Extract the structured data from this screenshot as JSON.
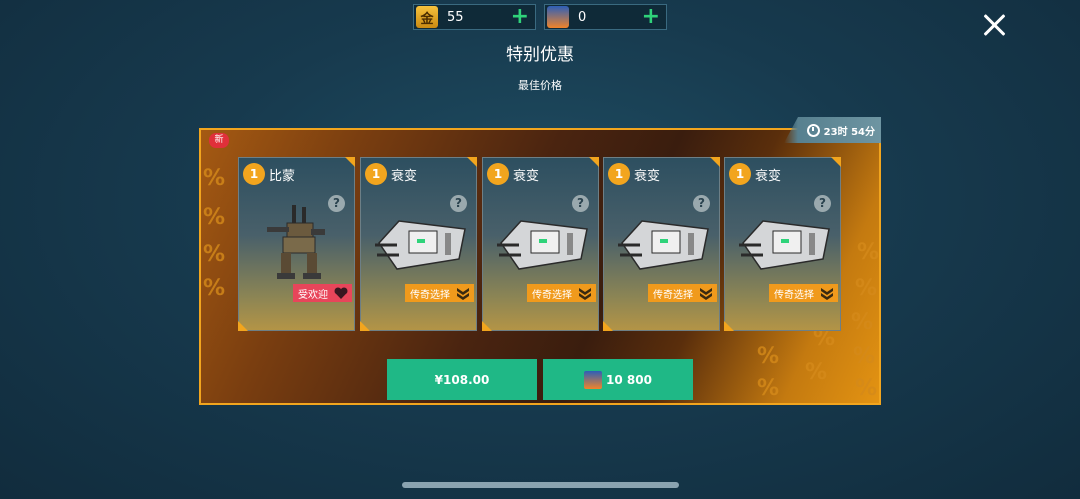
{
  "currency": {
    "gold": {
      "icon_text": "金",
      "value": "55"
    },
    "gems": {
      "value": "0"
    },
    "plus": "+"
  },
  "header": {
    "title": "特别优惠",
    "subtitle": "最佳价格"
  },
  "badge_new": "新",
  "timer": "23时 54分",
  "cards": [
    {
      "qty": "1",
      "name": "比蒙",
      "tag": "受欢迎",
      "help": "?"
    },
    {
      "qty": "1",
      "name": "衰变",
      "tag": "传奇选择",
      "help": "?"
    },
    {
      "qty": "1",
      "name": "衰变",
      "tag": "传奇选择",
      "help": "?"
    },
    {
      "qty": "1",
      "name": "衰变",
      "tag": "传奇选择",
      "help": "?"
    },
    {
      "qty": "1",
      "name": "衰变",
      "tag": "传奇选择",
      "help": "?"
    }
  ],
  "buttons": {
    "price_money": "¥108.00",
    "price_gems": "10 800"
  },
  "colors": {
    "accent_orange": "#f2a51e",
    "buy_green": "#1fb886",
    "plus_green": "#2fd37a",
    "popular_red": "#e8455a"
  },
  "icons": {
    "close": "close-icon",
    "clock": "clock-icon",
    "help": "question-icon",
    "popular": "heart-icon",
    "legend": "rank-chevron-icon"
  }
}
